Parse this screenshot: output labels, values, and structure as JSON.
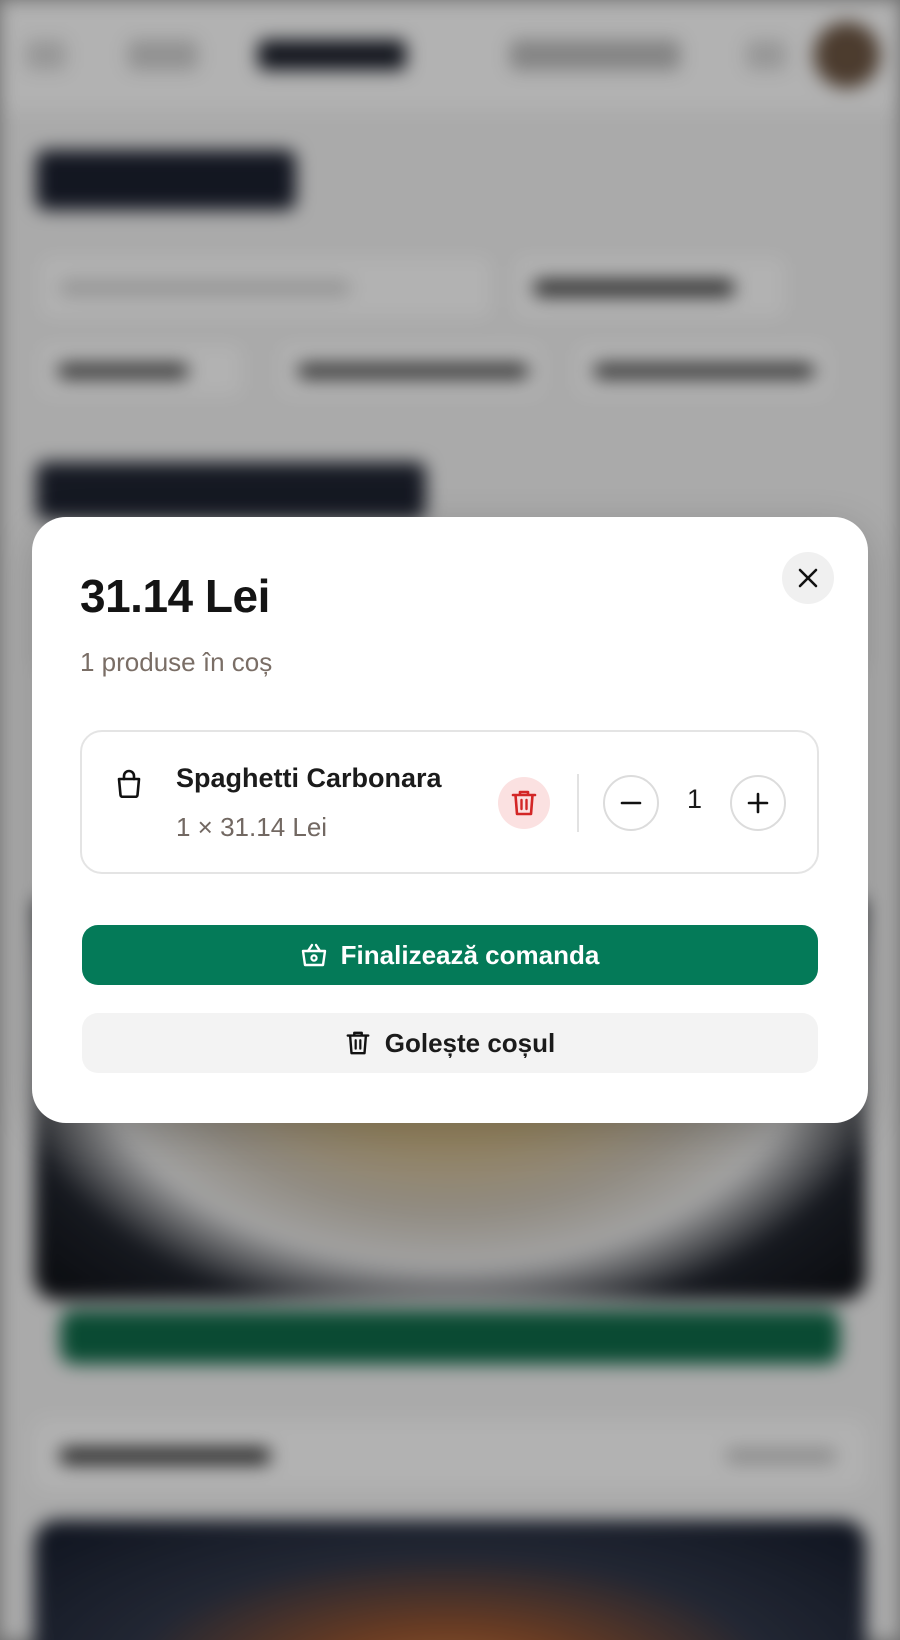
{
  "colors": {
    "primary_green": "#047a58",
    "danger_red": "#d32626",
    "danger_bg": "#fbe1e1",
    "muted_text": "#7a6e66"
  },
  "cart_modal": {
    "total": "31.14 Lei",
    "item_count_text": "1 produse în coș",
    "close_icon": "close-icon",
    "items": [
      {
        "icon": "shopping-bag-icon",
        "name": "Spaghetti Carbonara",
        "price_line": "1 × 31.14 Lei",
        "quantity": "1",
        "delete_icon": "trash-icon",
        "decrease_icon": "minus-icon",
        "increase_icon": "plus-icon"
      }
    ],
    "checkout": {
      "icon": "basket-icon",
      "label": "Finalizează comanda"
    },
    "empty_cart": {
      "icon": "trash-icon",
      "label": "Golește coșul"
    }
  }
}
